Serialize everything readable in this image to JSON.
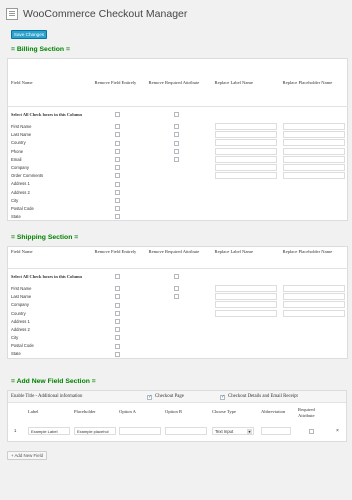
{
  "page": {
    "title": "WooCommerce Checkout Manager",
    "save_label": "Save Changes"
  },
  "columns": {
    "field_name": "Field Name",
    "remove_field": "Remove Field Entirely",
    "remove_required": "Remove Required Attribute",
    "replace_label": "Replace Label Name",
    "replace_placeholder": "Replace Placeholder Name"
  },
  "select_all_label": "Select All Check boxes in this Column",
  "billing": {
    "heading": "= Billing Section =",
    "rows": [
      "First Name",
      "Last Name",
      "Country",
      "Phone",
      "Email",
      "Company",
      "Order Comments",
      "Address 1",
      "Address 2",
      "City",
      "Postal Code",
      "State"
    ]
  },
  "shipping": {
    "heading": "= Shipping Section =",
    "rows": [
      "First Name",
      "Last Name",
      "Company",
      "Country",
      "Address 1",
      "Address 2",
      "City",
      "Postal Code",
      "State"
    ]
  },
  "add_new": {
    "heading": "= Add New Field Section =",
    "enable_title": "Enable Title - Additional information",
    "checkout_page": "Checkout Page",
    "checkout_details": "Checkout Details and Email Receipt",
    "headers": [
      "Label",
      "Placeholder",
      "Option A",
      "Option B",
      "Choose Type",
      "Abbreviation",
      "Required Attribute"
    ],
    "row": {
      "index": "1",
      "label": "Example Label",
      "placeholder": "Example placehol",
      "type": "Text Input",
      "remove": "×"
    },
    "add_button": "+ Add New Field"
  }
}
